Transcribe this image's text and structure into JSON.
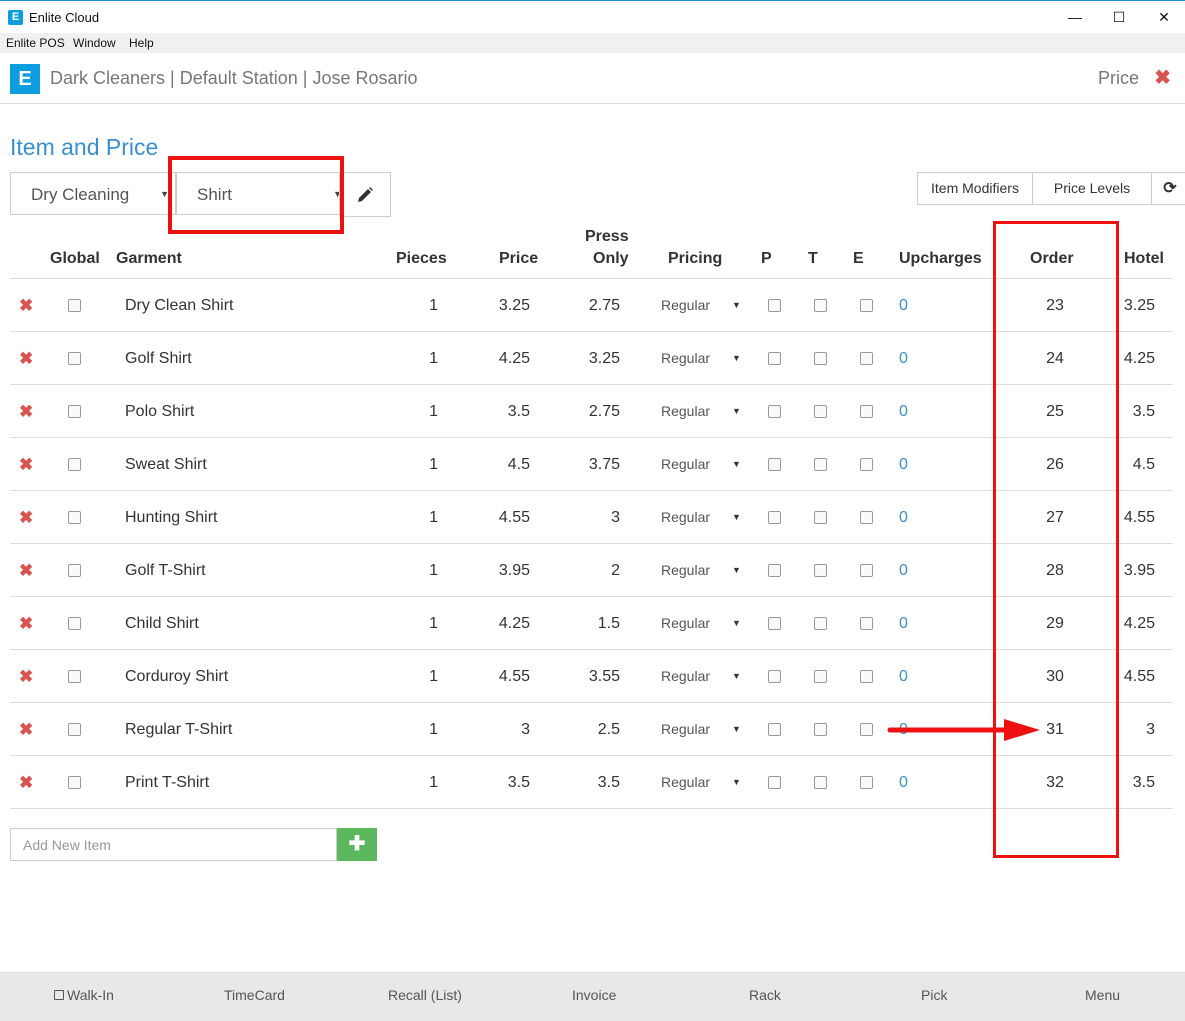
{
  "window": {
    "title": "Enlite Cloud",
    "minimize": "—",
    "maximize": "☐",
    "close": "✕"
  },
  "menu": [
    "Enlite POS",
    "Window",
    "Help"
  ],
  "header": {
    "logo": "E",
    "title": "Dark Cleaners | Default Station | Jose Rosario",
    "right": "Price",
    "close": "✖"
  },
  "page_title": "Item and Price",
  "category_select": "Dry Cleaning",
  "item_select": "Shirt",
  "buttons": {
    "item_modifiers": "Item Modifiers",
    "price_levels": "Price Levels",
    "refresh": "⟳"
  },
  "columns": [
    "Global",
    "Garment",
    "Pieces",
    "Price",
    "Press",
    "Only",
    "Pricing",
    "P",
    "T",
    "E",
    "Upcharges",
    "Order",
    "Hotel"
  ],
  "rows": [
    {
      "garment": "Dry Clean Shirt",
      "pieces": "1",
      "price": "3.25",
      "press": "2.75",
      "pricing": "Regular",
      "upcharges": "0",
      "order": "23",
      "hotel": "3.25"
    },
    {
      "garment": "Golf Shirt",
      "pieces": "1",
      "price": "4.25",
      "press": "3.25",
      "pricing": "Regular",
      "upcharges": "0",
      "order": "24",
      "hotel": "4.25"
    },
    {
      "garment": "Polo Shirt",
      "pieces": "1",
      "price": "3.5",
      "press": "2.75",
      "pricing": "Regular",
      "upcharges": "0",
      "order": "25",
      "hotel": "3.5"
    },
    {
      "garment": "Sweat Shirt",
      "pieces": "1",
      "price": "4.5",
      "press": "3.75",
      "pricing": "Regular",
      "upcharges": "0",
      "order": "26",
      "hotel": "4.5"
    },
    {
      "garment": "Hunting Shirt",
      "pieces": "1",
      "price": "4.55",
      "press": "3",
      "pricing": "Regular",
      "upcharges": "0",
      "order": "27",
      "hotel": "4.55"
    },
    {
      "garment": "Golf T-Shirt",
      "pieces": "1",
      "price": "3.95",
      "press": "2",
      "pricing": "Regular",
      "upcharges": "0",
      "order": "28",
      "hotel": "3.95"
    },
    {
      "garment": "Child Shirt",
      "pieces": "1",
      "price": "4.25",
      "press": "1.5",
      "pricing": "Regular",
      "upcharges": "0",
      "order": "29",
      "hotel": "4.25"
    },
    {
      "garment": "Corduroy Shirt",
      "pieces": "1",
      "price": "4.55",
      "press": "3.55",
      "pricing": "Regular",
      "upcharges": "0",
      "order": "30",
      "hotel": "4.55"
    },
    {
      "garment": "Regular T-Shirt",
      "pieces": "1",
      "price": "3",
      "press": "2.5",
      "pricing": "Regular",
      "upcharges": "0",
      "order": "31",
      "hotel": "3"
    },
    {
      "garment": "Print T-Shirt",
      "pieces": "1",
      "price": "3.5",
      "press": "3.5",
      "pricing": "Regular",
      "upcharges": "0",
      "order": "32",
      "hotel": "3.5"
    }
  ],
  "add_item": {
    "placeholder": "Add New Item",
    "button": "✚"
  },
  "bottom": [
    "Walk-In",
    "TimeCard",
    "Recall (List)",
    "Invoice",
    "Rack",
    "Pick",
    "Menu"
  ],
  "colors": {
    "accent": "#3a8fd0",
    "brand": "#0e9ee0",
    "delete": "#d9534f",
    "add": "#5cb85c",
    "highlight": "#ee1111"
  }
}
